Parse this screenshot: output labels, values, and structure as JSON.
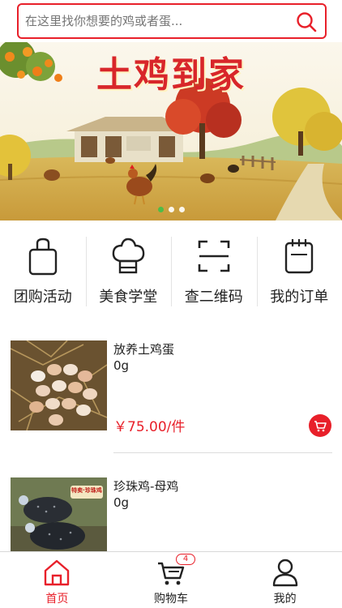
{
  "search": {
    "placeholder": "在这里找你想要的鸡或者蛋..."
  },
  "banner": {
    "title": "土鸡到家",
    "slides": 3,
    "active_slide": 1
  },
  "quick_nav": [
    {
      "label": "团购活动",
      "icon": "shopping-bag-icon"
    },
    {
      "label": "美食学堂",
      "icon": "chef-hat-icon"
    },
    {
      "label": "查二维码",
      "icon": "scan-frame-icon"
    },
    {
      "label": "我的订单",
      "icon": "notepad-icon"
    }
  ],
  "products": [
    {
      "name": "放养土鸡蛋",
      "weight": "0g",
      "price": "￥75.00/件"
    },
    {
      "name": "珍珠鸡-母鸡",
      "weight": "0g",
      "price": "",
      "image_sign": "特卖·珍珠鸡"
    }
  ],
  "tabbar": {
    "tabs": [
      {
        "label": "首页",
        "icon": "home-icon",
        "active": true
      },
      {
        "label": "购物车",
        "icon": "cart-icon",
        "badge": "4"
      },
      {
        "label": "我的",
        "icon": "user-icon"
      }
    ]
  },
  "colors": {
    "accent": "#e8202a",
    "active_dot": "#3fbf49"
  }
}
